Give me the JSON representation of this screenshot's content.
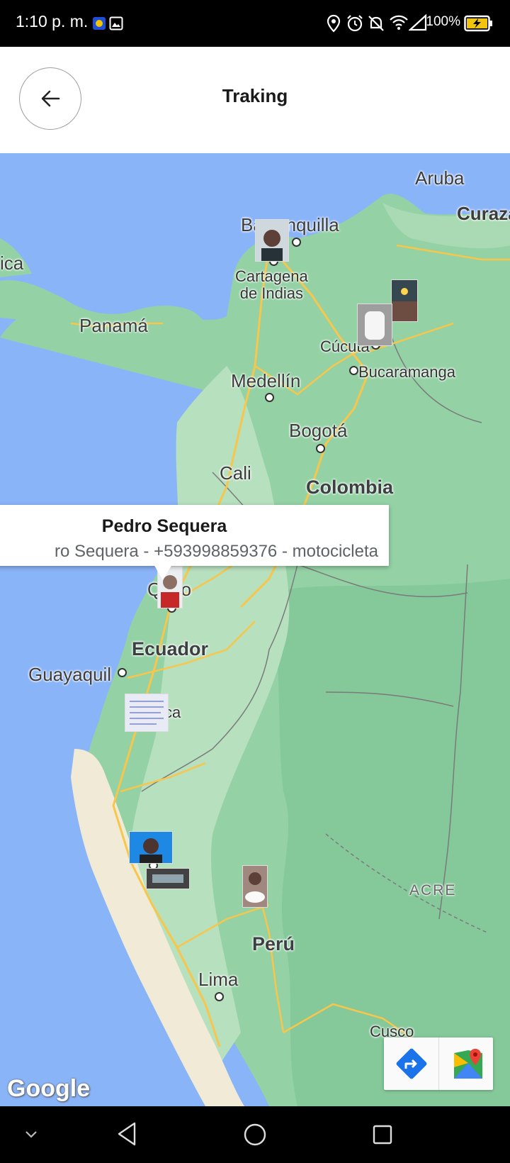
{
  "status_bar": {
    "time": "1:10 p. m.",
    "battery": "100%"
  },
  "app_bar": {
    "title": "Traking",
    "back_icon": "arrow-left-icon"
  },
  "map": {
    "labels": {
      "aruba": "Aruba",
      "curazao": "Curaza",
      "barranquilla": "Barranquilla",
      "ica": "ica",
      "cartagena": "Cartagena\nde Indias",
      "panama": "Panamá",
      "cucuta": "Cúcuta",
      "bucaramanga": "Bucaramanga",
      "medellin": "Medellín",
      "bogota": "Bogotá",
      "cali": "Cali",
      "colombia": "Colombia",
      "quito": "Quito",
      "ecuador": "Ecuador",
      "guayaquil": "Guayaquil",
      "cuenca": "ca",
      "acre": "ACRE",
      "peru": "Perú",
      "lima": "Lima",
      "cusco": "Cusco"
    },
    "info_window": {
      "title": "Pedro Sequera",
      "subtitle": "ro Sequera - +593998859376 - motocicleta"
    },
    "attribution": "Google",
    "directions_icon": "directions-icon",
    "google-maps-icon": "google-maps-icon"
  },
  "nav_bar": {
    "icons": [
      "chevron-down-icon",
      "back-triangle-icon",
      "home-circle-icon",
      "recents-square-icon"
    ]
  }
}
